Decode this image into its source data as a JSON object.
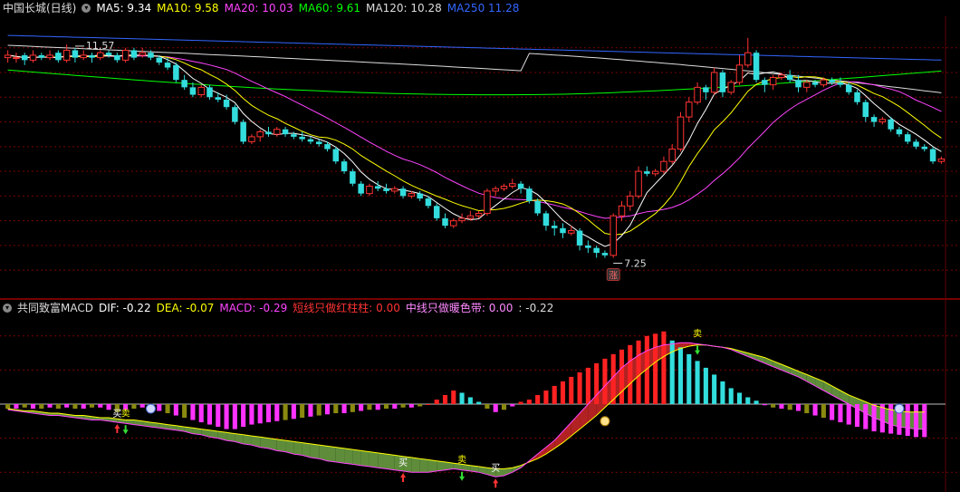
{
  "top_legend": {
    "title": "中国长城(日线)",
    "items": [
      {
        "text": "MA5: 9.34",
        "color": "#ffffff"
      },
      {
        "text": "MA10: 9.58",
        "color": "#ffff00"
      },
      {
        "text": "MA20: 10.03",
        "color": "#ff44ff"
      },
      {
        "text": "MA60: 9.61",
        "color": "#00ff00"
      },
      {
        "text": "MA120: 10.28",
        "color": "#dddddd"
      },
      {
        "text": "MA250  11.28",
        "color": "#3366ff"
      }
    ]
  },
  "bottom_legend": {
    "title": "共同致富MACD",
    "items": [
      {
        "text": "DIF: -0.22",
        "color": "#ffffff"
      },
      {
        "text": "DEA: -0.07",
        "color": "#ffff00"
      },
      {
        "text": "MACD: -0.29",
        "color": "#ff44ff"
      },
      {
        "text": "短线只做红柱柱: 0.00",
        "color": "#ff3333"
      },
      {
        "text": "中线只做暖色带: 0.00",
        "color": "#ff88ff"
      },
      {
        "text": ": -0.22",
        "color": "#dddddd"
      }
    ]
  },
  "chart_data": [
    {
      "type": "candlestick",
      "title": "中国长城(日线)",
      "ylim": [
        6.6,
        12.1
      ],
      "annotations": [
        {
          "text": "11.57",
          "x_index": 8,
          "y": 11.57
        },
        {
          "text": "7.25",
          "x_index": 72,
          "y": 7.25
        },
        {
          "text": "涨",
          "x_index": 72,
          "y": 7.0
        }
      ],
      "candles": [
        [
          11.3,
          11.35,
          11.45,
          11.2
        ],
        [
          11.3,
          11.3,
          11.4,
          11.2
        ],
        [
          11.35,
          11.25,
          11.4,
          11.15
        ],
        [
          11.25,
          11.35,
          11.45,
          11.2
        ],
        [
          11.35,
          11.3,
          11.4,
          11.25
        ],
        [
          11.3,
          11.35,
          11.45,
          11.25
        ],
        [
          11.4,
          11.25,
          11.45,
          11.2
        ],
        [
          11.25,
          11.45,
          11.57,
          11.2
        ],
        [
          11.45,
          11.3,
          11.5,
          11.2
        ],
        [
          11.3,
          11.35,
          11.45,
          11.25
        ],
        [
          11.35,
          11.3,
          11.4,
          11.2
        ],
        [
          11.3,
          11.4,
          11.45,
          11.25
        ],
        [
          11.4,
          11.35,
          11.45,
          11.3
        ],
        [
          11.35,
          11.25,
          11.4,
          11.2
        ],
        [
          11.25,
          11.45,
          11.5,
          11.2
        ],
        [
          11.45,
          11.3,
          11.5,
          11.25
        ],
        [
          11.35,
          11.4,
          11.5,
          11.3
        ],
        [
          11.4,
          11.3,
          11.45,
          11.25
        ],
        [
          11.3,
          11.2,
          11.35,
          11.15
        ],
        [
          11.2,
          11.1,
          11.3,
          11.05
        ],
        [
          11.15,
          10.85,
          11.2,
          10.8
        ],
        [
          10.85,
          10.7,
          10.95,
          10.65
        ],
        [
          10.7,
          10.55,
          10.8,
          10.5
        ],
        [
          10.55,
          10.7,
          10.75,
          10.5
        ],
        [
          10.7,
          10.5,
          10.75,
          10.45
        ],
        [
          10.5,
          10.45,
          10.6,
          10.4
        ],
        [
          10.45,
          10.3,
          10.55,
          10.25
        ],
        [
          10.3,
          10.0,
          10.35,
          9.95
        ],
        [
          10.0,
          9.6,
          10.05,
          9.55
        ],
        [
          9.6,
          9.7,
          9.75,
          9.55
        ],
        [
          9.7,
          9.8,
          9.85,
          9.6
        ],
        [
          9.8,
          9.75,
          9.9,
          9.7
        ],
        [
          9.75,
          9.85,
          9.9,
          9.7
        ],
        [
          9.85,
          9.75,
          9.9,
          9.7
        ],
        [
          9.75,
          9.7,
          9.8,
          9.65
        ],
        [
          9.7,
          9.65,
          9.8,
          9.6
        ],
        [
          9.65,
          9.6,
          9.7,
          9.55
        ],
        [
          9.6,
          9.55,
          9.65,
          9.5
        ],
        [
          9.55,
          9.45,
          9.6,
          9.4
        ],
        [
          9.45,
          9.2,
          9.5,
          9.15
        ],
        [
          9.2,
          9.0,
          9.25,
          8.95
        ],
        [
          9.0,
          8.75,
          9.05,
          8.7
        ],
        [
          8.75,
          8.55,
          8.8,
          8.5
        ],
        [
          8.55,
          8.7,
          8.75,
          8.5
        ],
        [
          8.7,
          8.65,
          8.8,
          8.6
        ],
        [
          8.65,
          8.6,
          8.75,
          8.55
        ],
        [
          8.6,
          8.65,
          8.7,
          8.55
        ],
        [
          8.65,
          8.5,
          8.7,
          8.45
        ],
        [
          8.5,
          8.55,
          8.6,
          8.45
        ],
        [
          8.55,
          8.45,
          8.6,
          8.4
        ],
        [
          8.45,
          8.3,
          8.5,
          8.25
        ],
        [
          8.3,
          8.05,
          8.35,
          8.0
        ],
        [
          8.05,
          7.9,
          8.15,
          7.85
        ],
        [
          7.9,
          8.0,
          8.05,
          7.85
        ],
        [
          8.0,
          8.05,
          8.15,
          7.95
        ],
        [
          8.05,
          8.1,
          8.2,
          8.0
        ],
        [
          8.1,
          8.15,
          8.2,
          8.05
        ],
        [
          8.15,
          8.6,
          8.65,
          8.1
        ],
        [
          8.6,
          8.65,
          8.7,
          8.5
        ],
        [
          8.65,
          8.7,
          8.75,
          8.6
        ],
        [
          8.7,
          8.75,
          8.85,
          8.65
        ],
        [
          8.75,
          8.65,
          8.8,
          8.55
        ],
        [
          8.65,
          8.4,
          8.7,
          8.35
        ],
        [
          8.4,
          8.15,
          8.45,
          8.1
        ],
        [
          8.15,
          7.9,
          8.2,
          7.8
        ],
        [
          7.9,
          7.85,
          8.0,
          7.7
        ],
        [
          7.85,
          7.75,
          7.95,
          7.65
        ],
        [
          7.75,
          7.8,
          7.9,
          7.7
        ],
        [
          7.8,
          7.5,
          7.85,
          7.4
        ],
        [
          7.5,
          7.45,
          7.6,
          7.35
        ],
        [
          7.45,
          7.35,
          7.5,
          7.25
        ],
        [
          7.35,
          7.3,
          7.4,
          7.25
        ],
        [
          7.3,
          8.1,
          8.15,
          7.25
        ],
        [
          8.1,
          8.3,
          8.4,
          8.0
        ],
        [
          8.3,
          8.5,
          8.6,
          8.2
        ],
        [
          8.5,
          9.0,
          9.1,
          8.45
        ],
        [
          9.0,
          8.95,
          9.1,
          8.9
        ],
        [
          8.95,
          9.0,
          9.05,
          8.9
        ],
        [
          9.0,
          9.2,
          9.3,
          8.95
        ],
        [
          9.2,
          9.45,
          9.55,
          9.15
        ],
        [
          9.45,
          10.1,
          10.2,
          9.4
        ],
        [
          10.1,
          10.4,
          10.5,
          10.0
        ],
        [
          10.4,
          10.7,
          10.8,
          10.35
        ],
        [
          10.7,
          10.6,
          10.75,
          10.45
        ],
        [
          10.6,
          11.0,
          11.1,
          10.55
        ],
        [
          11.0,
          10.6,
          11.05,
          10.5
        ],
        [
          10.6,
          10.8,
          10.85,
          10.55
        ],
        [
          10.8,
          11.15,
          11.35,
          10.75
        ],
        [
          11.15,
          11.4,
          11.7,
          11.1
        ],
        [
          11.4,
          10.85,
          11.45,
          10.8
        ],
        [
          10.85,
          10.75,
          10.9,
          10.6
        ],
        [
          10.75,
          10.9,
          10.95,
          10.65
        ],
        [
          10.9,
          10.95,
          11.0,
          10.85
        ],
        [
          10.95,
          10.85,
          11.05,
          10.8
        ],
        [
          10.85,
          10.7,
          10.95,
          10.6
        ],
        [
          10.7,
          10.8,
          10.85,
          10.6
        ],
        [
          10.8,
          10.75,
          10.85,
          10.7
        ],
        [
          10.75,
          10.85,
          10.9,
          10.7
        ],
        [
          10.85,
          10.8,
          10.9,
          10.75
        ],
        [
          10.8,
          10.75,
          10.9,
          10.7
        ],
        [
          10.75,
          10.6,
          10.8,
          10.55
        ],
        [
          10.6,
          10.4,
          10.65,
          10.35
        ],
        [
          10.4,
          10.1,
          10.45,
          10.0
        ],
        [
          10.1,
          10.0,
          10.15,
          9.9
        ],
        [
          10.0,
          10.05,
          10.1,
          9.95
        ],
        [
          10.05,
          9.85,
          10.1,
          9.8
        ],
        [
          9.85,
          9.75,
          9.9,
          9.7
        ],
        [
          9.75,
          9.6,
          9.8,
          9.55
        ],
        [
          9.6,
          9.5,
          9.65,
          9.45
        ],
        [
          9.5,
          9.45,
          9.55,
          9.4
        ],
        [
          9.45,
          9.2,
          9.5,
          9.15
        ],
        [
          9.2,
          9.25,
          9.3,
          9.15
        ]
      ]
    },
    {
      "type": "macd",
      "title": "共同致富MACD",
      "ylim": [
        -0.75,
        0.75
      ],
      "zero": 0,
      "series": [
        {
          "name": "DIF",
          "values": [
            -0.05,
            -0.06,
            -0.07,
            -0.08,
            -0.09,
            -0.1,
            -0.1,
            -0.11,
            -0.12,
            -0.13,
            -0.14,
            -0.14,
            -0.15,
            -0.16,
            -0.17,
            -0.18,
            -0.19,
            -0.2,
            -0.21,
            -0.22,
            -0.23,
            -0.24,
            -0.26,
            -0.27,
            -0.29,
            -0.3,
            -0.32,
            -0.33,
            -0.35,
            -0.36,
            -0.38,
            -0.39,
            -0.41,
            -0.42,
            -0.44,
            -0.45,
            -0.47,
            -0.48,
            -0.5,
            -0.51,
            -0.52,
            -0.53,
            -0.54,
            -0.55,
            -0.56,
            -0.57,
            -0.58,
            -0.59,
            -0.6,
            -0.6,
            -0.6,
            -0.59,
            -0.58,
            -0.57,
            -0.58,
            -0.59,
            -0.6,
            -0.62,
            -0.64,
            -0.63,
            -0.6,
            -0.56,
            -0.5,
            -0.44,
            -0.38,
            -0.32,
            -0.24,
            -0.16,
            -0.08,
            0.0,
            0.08,
            0.16,
            0.24,
            0.32,
            0.38,
            0.43,
            0.47,
            0.5,
            0.52,
            0.53,
            0.54,
            0.54,
            0.53,
            0.52,
            0.51,
            0.5,
            0.48,
            0.45,
            0.42,
            0.39,
            0.36,
            0.33,
            0.3,
            0.27,
            0.24,
            0.2,
            0.16,
            0.12,
            0.08,
            0.04,
            0.0,
            -0.04,
            -0.08,
            -0.12,
            -0.15,
            -0.18,
            -0.2,
            -0.21,
            -0.22,
            -0.22
          ]
        },
        {
          "name": "DEA",
          "values": [
            -0.04,
            -0.05,
            -0.06,
            -0.06,
            -0.07,
            -0.08,
            -0.08,
            -0.09,
            -0.1,
            -0.1,
            -0.11,
            -0.12,
            -0.12,
            -0.13,
            -0.14,
            -0.14,
            -0.15,
            -0.16,
            -0.17,
            -0.18,
            -0.19,
            -0.2,
            -0.21,
            -0.22,
            -0.23,
            -0.24,
            -0.25,
            -0.26,
            -0.27,
            -0.28,
            -0.29,
            -0.3,
            -0.31,
            -0.32,
            -0.33,
            -0.34,
            -0.35,
            -0.36,
            -0.37,
            -0.38,
            -0.39,
            -0.4,
            -0.41,
            -0.42,
            -0.43,
            -0.44,
            -0.45,
            -0.46,
            -0.47,
            -0.48,
            -0.49,
            -0.5,
            -0.51,
            -0.52,
            -0.53,
            -0.54,
            -0.55,
            -0.56,
            -0.57,
            -0.57,
            -0.56,
            -0.54,
            -0.51,
            -0.48,
            -0.44,
            -0.39,
            -0.34,
            -0.28,
            -0.22,
            -0.16,
            -0.1,
            -0.03,
            0.04,
            0.11,
            0.18,
            0.25,
            0.31,
            0.37,
            0.42,
            0.46,
            0.49,
            0.51,
            0.52,
            0.52,
            0.51,
            0.5,
            0.49,
            0.47,
            0.45,
            0.43,
            0.41,
            0.38,
            0.35,
            0.32,
            0.29,
            0.26,
            0.23,
            0.2,
            0.16,
            0.12,
            0.08,
            0.05,
            0.02,
            -0.01,
            -0.03,
            -0.05,
            -0.06,
            -0.07,
            -0.07,
            -0.07
          ]
        },
        {
          "name": "MACD",
          "values": [
            -0.04,
            -0.04,
            -0.03,
            -0.04,
            -0.04,
            -0.03,
            -0.04,
            -0.03,
            -0.04,
            -0.04,
            -0.03,
            -0.03,
            -0.05,
            -0.07,
            -0.05,
            -0.04,
            -0.03,
            -0.04,
            -0.06,
            -0.08,
            -0.1,
            -0.12,
            -0.14,
            -0.16,
            -0.18,
            -0.2,
            -0.22,
            -0.22,
            -0.2,
            -0.18,
            -0.17,
            -0.16,
            -0.15,
            -0.14,
            -0.13,
            -0.12,
            -0.11,
            -0.1,
            -0.09,
            -0.08,
            -0.08,
            -0.07,
            -0.06,
            -0.05,
            -0.05,
            -0.04,
            -0.04,
            -0.03,
            -0.03,
            -0.02,
            0.0,
            0.04,
            0.08,
            0.12,
            0.1,
            0.06,
            0.02,
            -0.04,
            -0.07,
            -0.05,
            -0.02,
            0.02,
            0.04,
            0.08,
            0.12,
            0.16,
            0.2,
            0.24,
            0.28,
            0.32,
            0.36,
            0.4,
            0.44,
            0.48,
            0.52,
            0.56,
            0.6,
            0.62,
            0.64,
            0.56,
            0.5,
            0.44,
            0.38,
            0.32,
            0.26,
            0.2,
            0.14,
            0.1,
            0.06,
            0.03,
            -0.01,
            -0.03,
            -0.04,
            -0.05,
            -0.06,
            -0.08,
            -0.1,
            -0.12,
            -0.14,
            -0.16,
            -0.18,
            -0.2,
            -0.22,
            -0.24,
            -0.25,
            -0.26,
            -0.27,
            -0.28,
            -0.29,
            -0.29
          ]
        }
      ],
      "signals": [
        {
          "text": "买",
          "x_index": 13,
          "kind": "buy"
        },
        {
          "text": "卖",
          "x_index": 14,
          "kind": "sell"
        },
        {
          "text": "买",
          "x_index": 47,
          "kind": "buy"
        },
        {
          "text": "卖",
          "x_index": 54,
          "kind": "sell"
        },
        {
          "text": "买",
          "x_index": 58,
          "kind": "buy"
        },
        {
          "text": "卖",
          "x_index": 82,
          "kind": "sell"
        }
      ]
    }
  ],
  "colors": {
    "up": "#ff3333",
    "down": "#33dddd",
    "ma5": "#ffffff",
    "ma10": "#ffff00",
    "ma20": "#ff44ff",
    "ma60": "#00ff00",
    "ma120": "#dddddd",
    "ma250": "#3366ff",
    "grid": "#7a0000",
    "warm_band": "#b22222",
    "cool_band": "#5e8c3a",
    "macd_neg": "#ff33ff",
    "macd_neg_dim": "#8a8a10",
    "macd_pos": "#ff2222",
    "macd_pos_cool": "#33dddd"
  }
}
